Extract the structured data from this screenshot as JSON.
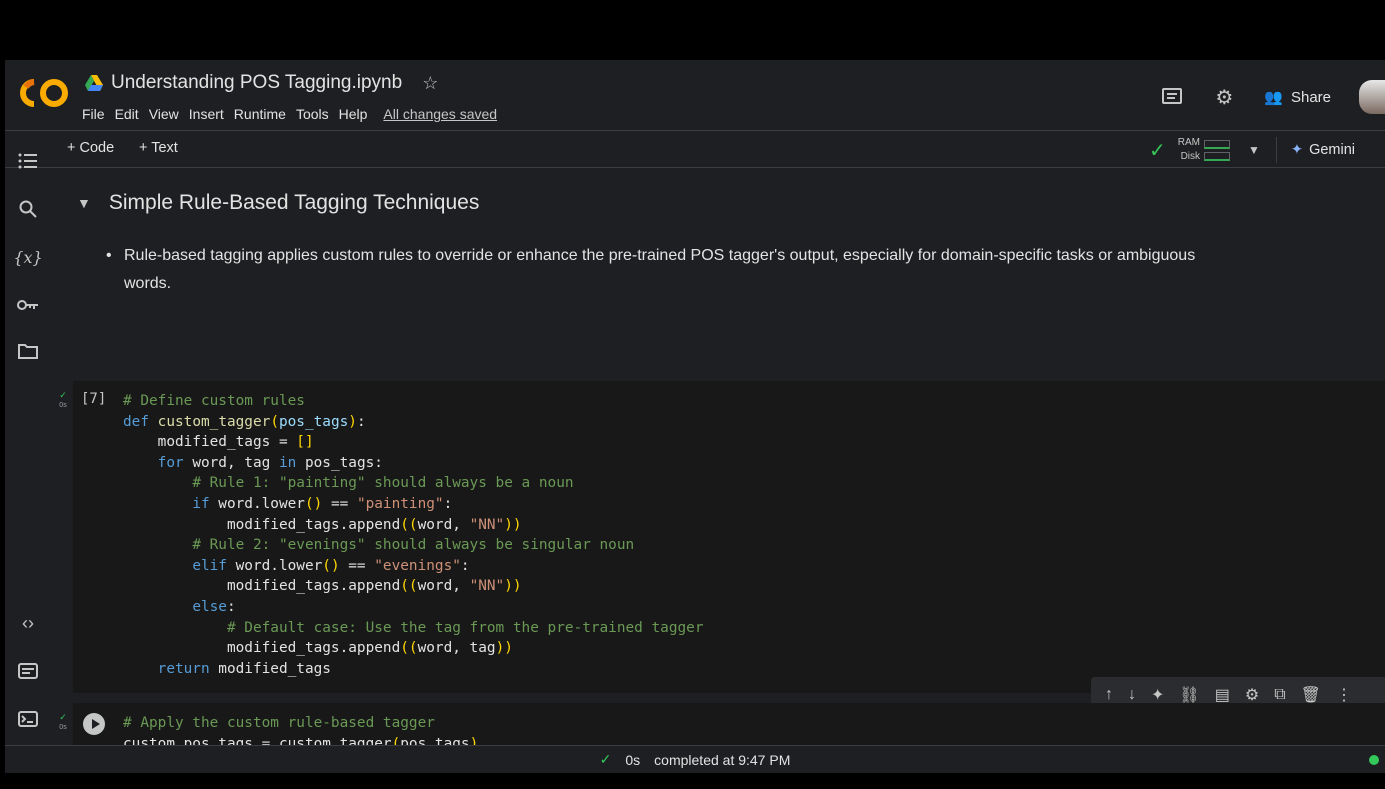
{
  "header": {
    "title": "Understanding POS Tagging.ipynb",
    "menu": [
      "File",
      "Edit",
      "View",
      "Insert",
      "Runtime",
      "Tools",
      "Help"
    ],
    "saved_status": "All changes saved",
    "share_label": "Share"
  },
  "toolbar": {
    "add_code": "+ Code",
    "add_text": "+ Text",
    "ram_label": "RAM",
    "disk_label": "Disk",
    "gemini_label": "Gemini"
  },
  "sidebar": {
    "icons": [
      "table-of-contents-icon",
      "search-icon",
      "variables-icon",
      "secrets-key-icon",
      "files-folder-icon",
      "code-snippets-icon",
      "command-palette-icon",
      "terminal-icon"
    ],
    "variables_glyph": "{x}"
  },
  "section": {
    "heading": "Simple Rule-Based Tagging Techniques",
    "bullet": "Rule-based tagging applies custom rules to override or enhance the pre-trained POS tagger's output, especially for domain-specific tasks or ambiguous words."
  },
  "cell1": {
    "exec_count": "[7]",
    "status_time": "0s"
  },
  "cell2": {
    "status_time": "0s"
  },
  "footer": {
    "check_time": "0s",
    "completed": "completed at 9:47 PM"
  },
  "colors": {
    "bg": "#1e1f22",
    "cell_bg": "#181818",
    "success": "#34c759",
    "accent": "#8ab4f8"
  }
}
